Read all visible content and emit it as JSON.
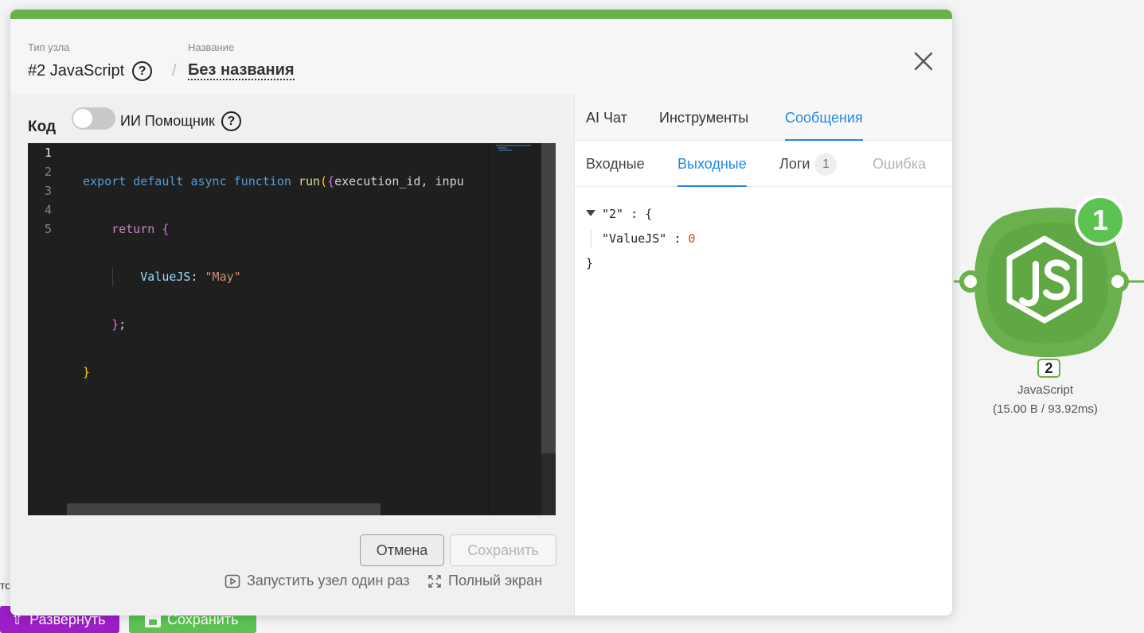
{
  "modal": {
    "node_type_caption": "Тип узла",
    "node_name_caption": "Название",
    "node_type": "#2 JavaScript",
    "separator": "/",
    "node_name": "Без названия",
    "help_glyph": "?"
  },
  "left": {
    "code_label": "Код",
    "ai_toggle_on": false,
    "ai_label": "ИИ Помощник",
    "line_numbers": [
      "1",
      "2",
      "3",
      "4",
      "5"
    ],
    "code": {
      "l1_export": "export",
      "l1_default": "default",
      "l1_async": "async",
      "l1_function": "function",
      "l1_name": "run",
      "l1_paren": "(",
      "l1_brace": "{",
      "l1_params": "execution_id, inpu",
      "l2_return": "return",
      "l2_brace": "{",
      "l3_key": "ValueJS",
      "l3_colon": ": ",
      "l3_value": "\"May\"",
      "l4_close": "}",
      "l4_semi": ";",
      "l5_close": "}"
    },
    "cancel_label": "Отмена",
    "save_label": "Сохранить",
    "run_once_label": "Запустить узел один раз",
    "fullscreen_label": "Полный экран"
  },
  "right": {
    "tabs": [
      "AI Чат",
      "Инструменты",
      "Сообщения"
    ],
    "active_tab": "Сообщения",
    "subtabs": [
      "Входные",
      "Выходные",
      "Логи",
      "Ошибка"
    ],
    "active_subtab": "Выходные",
    "logs_count": "1",
    "output_json": {
      "root_key": "\"2\"",
      "open": "{",
      "colon": ":",
      "key": "\"ValueJS\"",
      "value": "0",
      "close": "}"
    }
  },
  "background": {
    "deploy_label": "Развернуть",
    "save_label": "Сохранить",
    "node_badge": "1",
    "node_number": "2",
    "node_label": "JavaScript",
    "node_stats": "(15.00 B / 93.92ms)"
  },
  "colors": {
    "accent": "#1e88e5",
    "node_green": "#6ab04c",
    "deploy_purple": "#9c1ec8",
    "save_green": "#5cc353"
  },
  "icons": [
    "help-icon",
    "close-icon",
    "play-icon",
    "expand-icon",
    "upload-icon",
    "disk-icon",
    "js-logo-icon"
  ]
}
